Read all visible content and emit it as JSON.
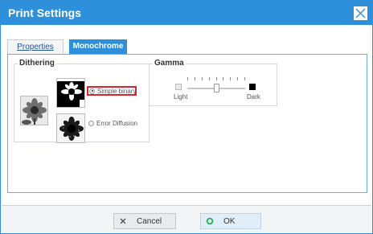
{
  "window": {
    "title": "Print Settings",
    "close_icon": "close-icon"
  },
  "tabs": [
    {
      "label": "Properties",
      "active": false
    },
    {
      "label": "Monochrome",
      "active": true
    }
  ],
  "dithering": {
    "title": "Dithering",
    "options": [
      {
        "label": "Simple binary",
        "selected": true
      },
      {
        "label": "Error Diffusion",
        "selected": false
      }
    ]
  },
  "gamma": {
    "title": "Gamma",
    "min_label": "Light",
    "max_label": "Dark",
    "tick_count": 9,
    "level": 0.5
  },
  "footer": {
    "cancel_label": "Cancel",
    "ok_label": "OK",
    "cancel_icon": "x-icon",
    "ok_icon": "circle-icon"
  },
  "colors": {
    "accent": "#2e90db",
    "highlight": "#d9262d",
    "ok_icon": "#22b14c"
  }
}
